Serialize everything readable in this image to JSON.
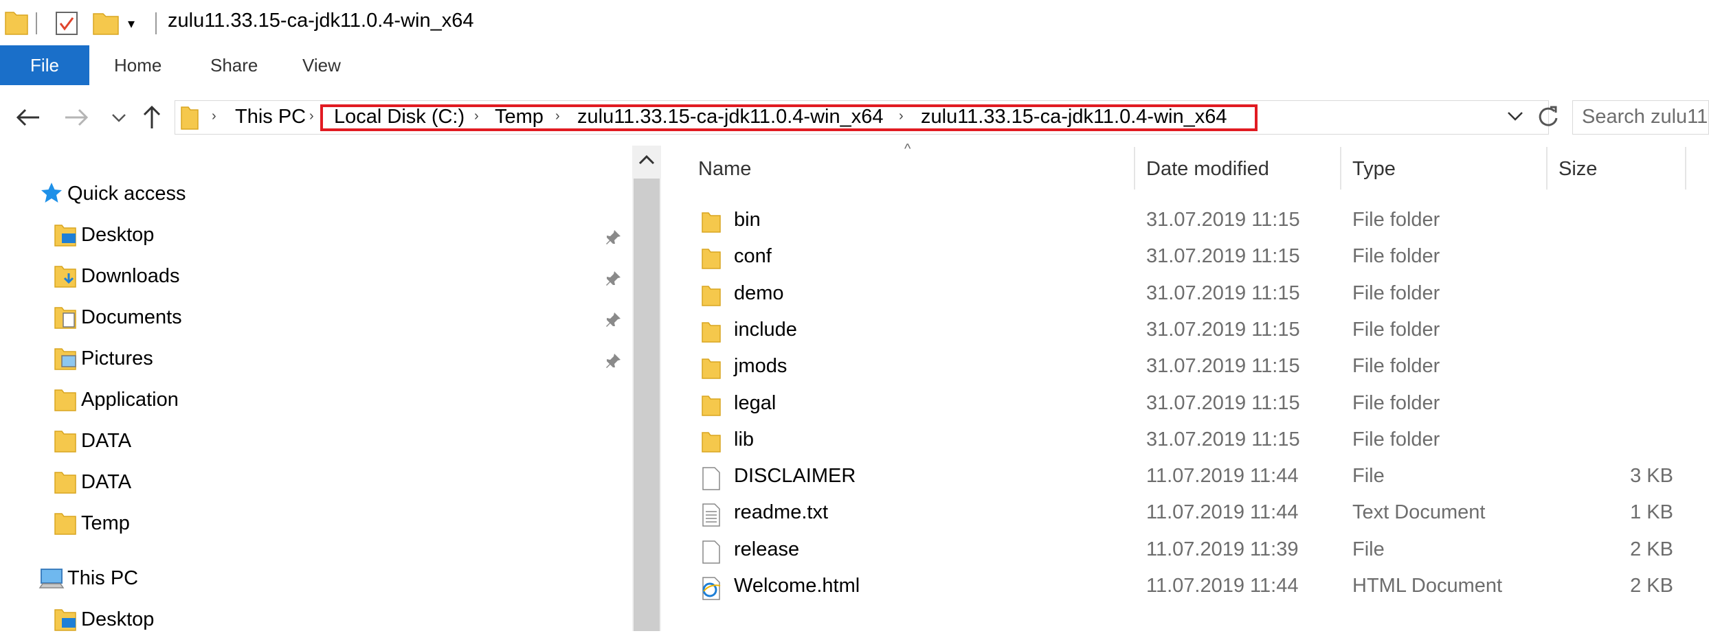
{
  "window": {
    "title": "zulu11.33.15-ca-jdk11.0.4-win_x64"
  },
  "ribbon": {
    "tabs": [
      "File",
      "Home",
      "Share",
      "View"
    ]
  },
  "address": {
    "crumbs": [
      "This PC",
      "Local Disk (C:)",
      "Temp",
      "zulu11.33.15-ca-jdk11.0.4-win_x64",
      "zulu11.33.15-ca-jdk11.0.4-win_x64"
    ],
    "highlight_color": "#e11b22"
  },
  "search": {
    "placeholder": "Search zulu11"
  },
  "nav": {
    "quick_access": "Quick access",
    "items": [
      {
        "label": "Desktop",
        "icon": "desktop-folder-icon",
        "pinned": true
      },
      {
        "label": "Downloads",
        "icon": "downloads-folder-icon",
        "pinned": true
      },
      {
        "label": "Documents",
        "icon": "documents-folder-icon",
        "pinned": true
      },
      {
        "label": "Pictures",
        "icon": "pictures-folder-icon",
        "pinned": true
      },
      {
        "label": "Application",
        "icon": "folder-icon",
        "pinned": false
      },
      {
        "label": "DATA",
        "icon": "folder-icon",
        "pinned": false
      },
      {
        "label": "DATA",
        "icon": "folder-icon",
        "pinned": false
      },
      {
        "label": "Temp",
        "icon": "folder-icon",
        "pinned": false
      }
    ],
    "this_pc": "This PC",
    "this_pc_items": [
      {
        "label": "Desktop",
        "icon": "desktop-folder-icon"
      }
    ]
  },
  "columns": {
    "name": "Name",
    "date": "Date modified",
    "type": "Type",
    "size": "Size"
  },
  "files": [
    {
      "name": "bin",
      "date": "31.07.2019 11:15",
      "type": "File folder",
      "size": "",
      "icon": "folder"
    },
    {
      "name": "conf",
      "date": "31.07.2019 11:15",
      "type": "File folder",
      "size": "",
      "icon": "folder"
    },
    {
      "name": "demo",
      "date": "31.07.2019 11:15",
      "type": "File folder",
      "size": "",
      "icon": "folder"
    },
    {
      "name": "include",
      "date": "31.07.2019 11:15",
      "type": "File folder",
      "size": "",
      "icon": "folder"
    },
    {
      "name": "jmods",
      "date": "31.07.2019 11:15",
      "type": "File folder",
      "size": "",
      "icon": "folder"
    },
    {
      "name": "legal",
      "date": "31.07.2019 11:15",
      "type": "File folder",
      "size": "",
      "icon": "folder"
    },
    {
      "name": "lib",
      "date": "31.07.2019 11:15",
      "type": "File folder",
      "size": "",
      "icon": "folder"
    },
    {
      "name": "DISCLAIMER",
      "date": "11.07.2019 11:44",
      "type": "File",
      "size": "3 KB",
      "icon": "file"
    },
    {
      "name": "readme.txt",
      "date": "11.07.2019 11:44",
      "type": "Text Document",
      "size": "1 KB",
      "icon": "text"
    },
    {
      "name": "release",
      "date": "11.07.2019 11:39",
      "type": "File",
      "size": "2 KB",
      "icon": "file"
    },
    {
      "name": "Welcome.html",
      "date": "11.07.2019 11:44",
      "type": "HTML Document",
      "size": "2 KB",
      "icon": "html"
    }
  ],
  "colors": {
    "file_tab": "#1a6fc9",
    "folder": "#f5c84c",
    "accent": "#1a6fc9"
  }
}
